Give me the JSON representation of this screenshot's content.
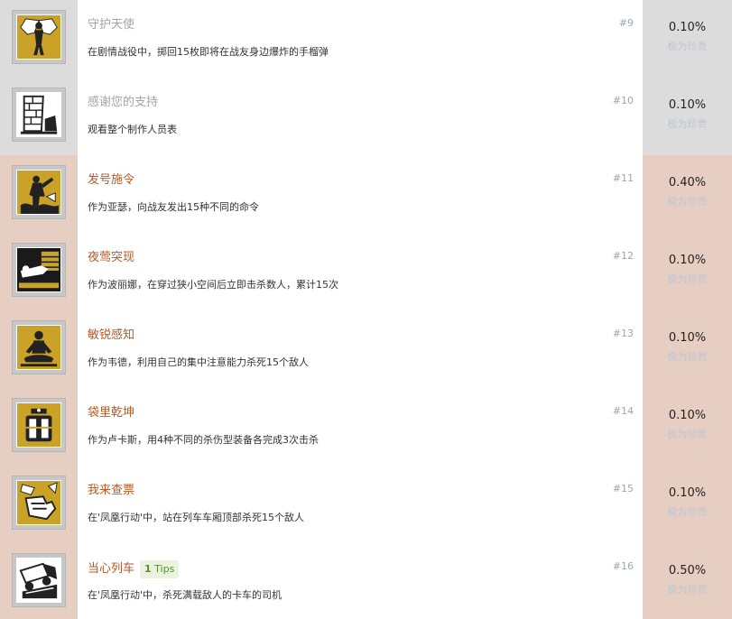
{
  "achievements": [
    {
      "title": "守护天使",
      "desc": "在剧情战役中，掷回15枚即将在战友身边爆炸的手榴弹",
      "num": "#9",
      "percent": "0.10%",
      "rarity": "极为珍贵",
      "icon": "angel-icon",
      "tips": null
    },
    {
      "title": "感谢您的支持",
      "desc": "观看整个制作人员表",
      "num": "#10",
      "percent": "0.10%",
      "rarity": "极为珍贵",
      "icon": "brick-wall-icon",
      "tips": null
    },
    {
      "title": "发号施令",
      "desc": "作为亚瑟，向战友发出15种不同的命令",
      "num": "#11",
      "percent": "0.40%",
      "rarity": "极为珍贵",
      "icon": "soldier-command-icon",
      "tips": null
    },
    {
      "title": "夜莺突现",
      "desc": "作为波丽娜，在穿过狭小空间后立即击杀数人，累计15次",
      "num": "#12",
      "percent": "0.10%",
      "rarity": "极为珍贵",
      "icon": "crawl-tunnel-icon",
      "tips": null
    },
    {
      "title": "敏锐感知",
      "desc": "作为韦德，利用自己的集中注意能力杀死15个敌人",
      "num": "#13",
      "percent": "0.10%",
      "rarity": "极为珍贵",
      "icon": "meditation-icon",
      "tips": null
    },
    {
      "title": "袋里乾坤",
      "desc": "作为卢卡斯，用4种不同的杀伤型装备各完成3次击杀",
      "num": "#14",
      "percent": "0.10%",
      "rarity": "极为珍贵",
      "icon": "explosives-icon",
      "tips": null
    },
    {
      "title": "我来查票",
      "desc": "在'凤凰行动'中，站在列车车厢顶部杀死15个敌人",
      "num": "#15",
      "percent": "0.10%",
      "rarity": "极为珍贵",
      "icon": "ticket-hand-icon",
      "tips": null
    },
    {
      "title": "当心列车",
      "desc": "在'凤凰行动'中，杀死满载敌人的卡车的司机",
      "num": "#16",
      "percent": "0.50%",
      "rarity": "极为珍贵",
      "icon": "truck-crash-icon",
      "tips": {
        "count": "1",
        "label": "Tips"
      }
    }
  ]
}
